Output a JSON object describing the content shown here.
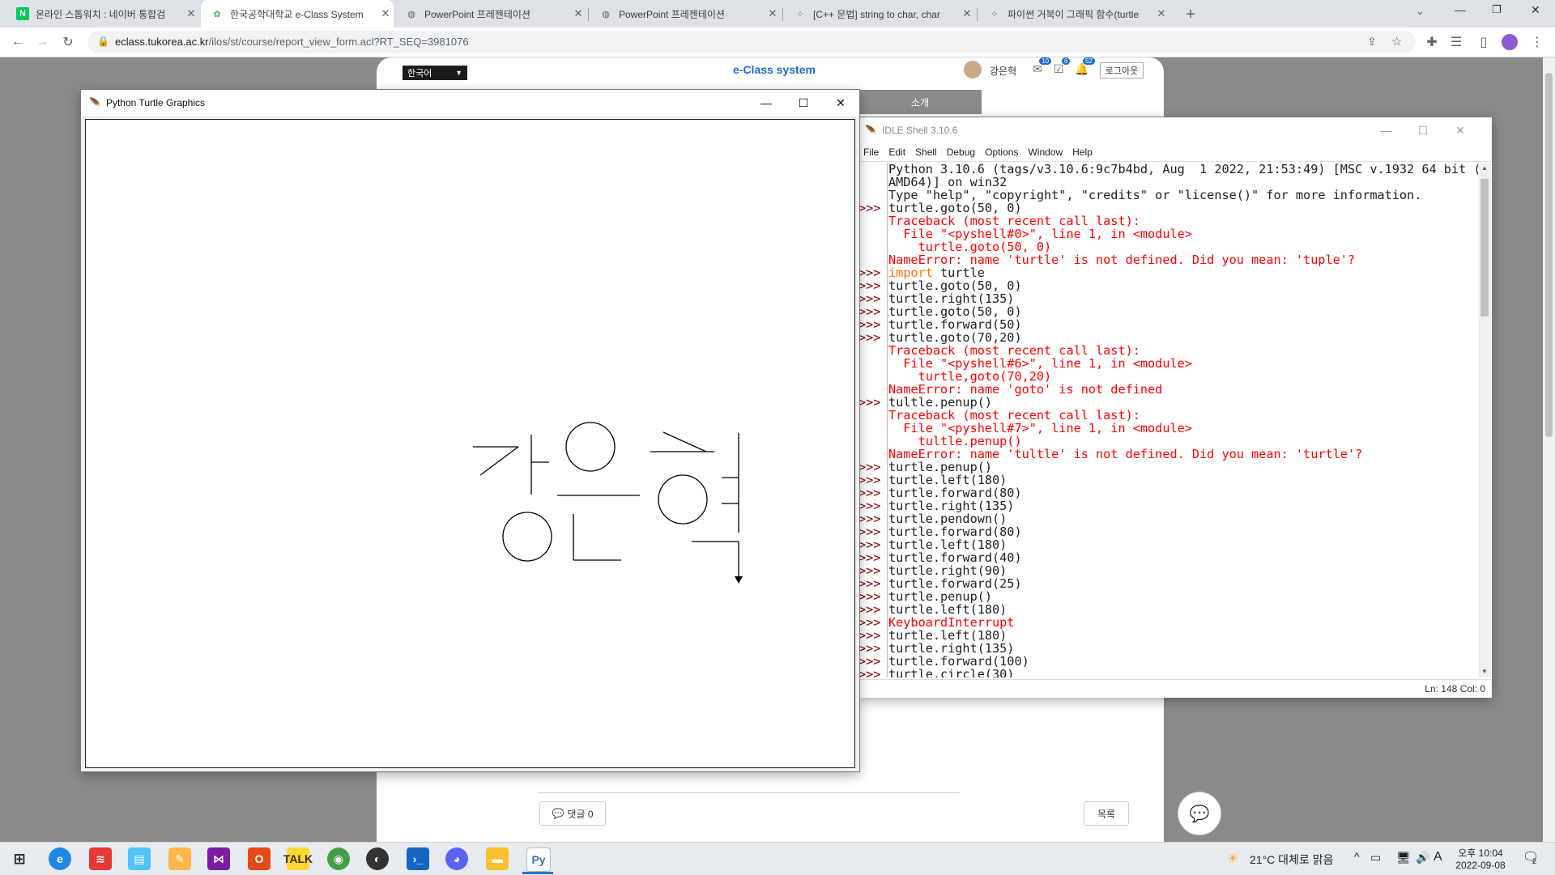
{
  "browser": {
    "tabs": [
      {
        "title": "온라인 스톱워치 : 네이버 통합검",
        "icon": "naver-icon",
        "active": false
      },
      {
        "title": "한국공학대학교 e-Class System",
        "icon": "eclass-icon",
        "active": true
      },
      {
        "title": "PowerPoint 프레젠테이션",
        "icon": "globe-icon",
        "active": false
      },
      {
        "title": "PowerPoint 프레젠테이션",
        "icon": "globe-icon",
        "active": false
      },
      {
        "title": "[C++ 문법] string to char, char",
        "icon": "tistory-icon",
        "active": false
      },
      {
        "title": "파이썬 거북이 그래픽 함수(turtle",
        "icon": "tistory-icon",
        "active": false
      }
    ],
    "new_tab": "+",
    "url_host": "eclass.tukorea.ac.kr",
    "url_path": "/ilos/st/course/report_view_form.acl?RT_SEQ=3981076"
  },
  "eclass": {
    "language": "한국어",
    "logo": "e-Class system",
    "user_name": "강은혁",
    "badges": [
      "10",
      "6",
      "52"
    ],
    "logout": "로그아웃",
    "nav_intro": "소개",
    "comment_button": "댓글 0",
    "list_button": "목록"
  },
  "turtle": {
    "title": "Python Turtle Graphics",
    "drawing": "강은혁"
  },
  "idle": {
    "title": "IDLE Shell 3.10.6",
    "menu": [
      "File",
      "Edit",
      "Shell",
      "Debug",
      "Options",
      "Window",
      "Help"
    ],
    "lines": [
      {
        "p": "",
        "t": "Python 3.10.6 (tags/v3.10.6:9c7b4bd, Aug  1 2022, 21:53:49) [MSC v.1932 64 bit (",
        "c": ""
      },
      {
        "p": "",
        "t": "AMD64)] on win32",
        "c": ""
      },
      {
        "p": "",
        "t": "Type \"help\", \"copyright\", \"credits\" or \"license()\" for more information.",
        "c": ""
      },
      {
        "p": ">>>",
        "t": "turtle.goto(50, 0)",
        "c": ""
      },
      {
        "p": "",
        "t": "Traceback (most recent call last):",
        "c": "err"
      },
      {
        "p": "",
        "t": "  File \"<pyshell#0>\", line 1, in <module>",
        "c": "err"
      },
      {
        "p": "",
        "t": "    turtle.goto(50, 0)",
        "c": "err"
      },
      {
        "p": "",
        "t": "NameError: name 'turtle' is not defined. Did you mean: 'tuple'?",
        "c": "err"
      },
      {
        "p": ">>>",
        "t": "import turtle",
        "c": "kw"
      },
      {
        "p": ">>>",
        "t": "turtle.goto(50, 0)",
        "c": ""
      },
      {
        "p": ">>>",
        "t": "turtle.right(135)",
        "c": ""
      },
      {
        "p": ">>>",
        "t": "turtle.goto(50, 0)",
        "c": ""
      },
      {
        "p": ">>>",
        "t": "turtle.forward(50)",
        "c": ""
      },
      {
        "p": ">>>",
        "t": "turtle.goto(70,20)",
        "c": ""
      },
      {
        "p": "",
        "t": "Traceback (most recent call last):",
        "c": "err"
      },
      {
        "p": "",
        "t": "  File \"<pyshell#6>\", line 1, in <module>",
        "c": "err"
      },
      {
        "p": "",
        "t": "    turtle,goto(70,20)",
        "c": "err"
      },
      {
        "p": "",
        "t": "NameError: name 'goto' is not defined",
        "c": "err"
      },
      {
        "p": ">>>",
        "t": "tultle.penup()",
        "c": ""
      },
      {
        "p": "",
        "t": "Traceback (most recent call last):",
        "c": "err"
      },
      {
        "p": "",
        "t": "  File \"<pyshell#7>\", line 1, in <module>",
        "c": "err"
      },
      {
        "p": "",
        "t": "    tultle.penup()",
        "c": "err"
      },
      {
        "p": "",
        "t": "NameError: name 'tultle' is not defined. Did you mean: 'turtle'?",
        "c": "err"
      },
      {
        "p": ">>>",
        "t": "turtle.penup()",
        "c": ""
      },
      {
        "p": ">>>",
        "t": "turtle.left(180)",
        "c": ""
      },
      {
        "p": ">>>",
        "t": "turtle.forward(80)",
        "c": ""
      },
      {
        "p": ">>>",
        "t": "turtle.right(135)",
        "c": ""
      },
      {
        "p": ">>>",
        "t": "turtle.pendown()",
        "c": ""
      },
      {
        "p": ">>>",
        "t": "turtle.forward(80)",
        "c": ""
      },
      {
        "p": ">>>",
        "t": "turtle.left(180)",
        "c": ""
      },
      {
        "p": ">>>",
        "t": "turtle.forward(40)",
        "c": ""
      },
      {
        "p": ">>>",
        "t": "turtle.right(90)",
        "c": ""
      },
      {
        "p": ">>>",
        "t": "turtle.forward(25)",
        "c": ""
      },
      {
        "p": ">>>",
        "t": "turtle.penup()",
        "c": ""
      },
      {
        "p": ">>>",
        "t": "turtle.left(180)",
        "c": ""
      },
      {
        "p": ">>>",
        "t": "KeyboardInterrupt",
        "c": "err"
      },
      {
        "p": ">>>",
        "t": "turtle.left(180)",
        "c": ""
      },
      {
        "p": ">>>",
        "t": "turtle.right(135)",
        "c": ""
      },
      {
        "p": ">>>",
        "t": "turtle.forward(100)",
        "c": ""
      },
      {
        "p": ">>>",
        "t": "turtle.circle(30)",
        "c": ""
      }
    ],
    "status": "Ln: 148   Col: 0"
  },
  "taskbar": {
    "weather": "21°C  대체로 맑음",
    "ime": "A",
    "time": "오후 10:04",
    "date": "2022-09-08",
    "notifications": "2"
  }
}
